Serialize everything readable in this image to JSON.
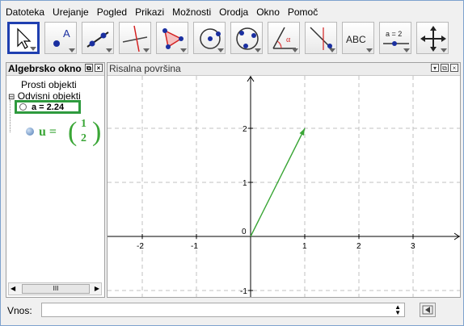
{
  "menu": [
    "Datoteka",
    "Urejanje",
    "Pogled",
    "Prikazi",
    "Možnosti",
    "Orodja",
    "Okno",
    "Pomoč"
  ],
  "toolbar": {
    "tools": [
      "move-tool",
      "point-tool",
      "line-tool",
      "perpendicular-tool",
      "polygon-tool",
      "circle-tool",
      "conic-tool",
      "angle-tool",
      "reflect-tool",
      "text-tool",
      "slider-tool",
      "move-view-tool"
    ],
    "text_tool_label": "ABC",
    "slider_tool_label": "a = 2"
  },
  "algebra": {
    "title": "Algebrsko okno",
    "free_objects": "Prosti objekti",
    "dependent_objects": "Odvisni objekti",
    "item_a": "a = 2.24",
    "item_u_name": "u =",
    "item_u_x": "1",
    "item_u_y": "2",
    "scroll_thumb": "III"
  },
  "graphics": {
    "title": "Risalna površina"
  },
  "input": {
    "label": "Vnos:",
    "value": ""
  },
  "colors": {
    "accent_selected": "#1f3fb0",
    "vector_green": "#3aa636",
    "highlight_box": "#2e9a3e"
  },
  "chart_data": {
    "type": "scatter",
    "x_ticks": [
      "-2",
      "-1",
      "0",
      "1",
      "2",
      "3"
    ],
    "y_ticks": [
      "2",
      "1",
      "-1"
    ],
    "origin_label": "0",
    "xlim": [
      -2.6,
      3.7
    ],
    "ylim": [
      -1.2,
      2.9
    ],
    "grid": true,
    "vector": {
      "from": [
        0,
        0
      ],
      "to": [
        1,
        2
      ]
    }
  }
}
